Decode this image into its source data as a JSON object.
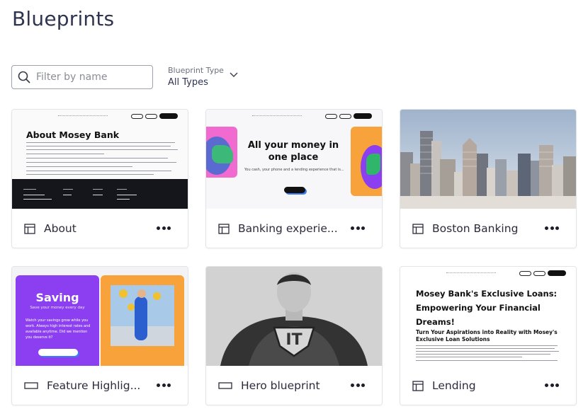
{
  "page": {
    "title": "Blueprints"
  },
  "filters": {
    "search_placeholder": "Filter by name",
    "type_label": "Blueprint Type",
    "type_value": "All Types"
  },
  "cards": [
    {
      "name": "About",
      "type_icon": "layout-template-icon",
      "thumb": {
        "heading": "About Mosey Bank"
      }
    },
    {
      "name": "Banking experie...",
      "type_icon": "layout-template-icon",
      "thumb": {
        "heading": "All your money in one place",
        "sub": "You cash, your phone and a lending experience that is..."
      }
    },
    {
      "name": "Boston Banking",
      "type_icon": "layout-template-icon",
      "thumb": {}
    },
    {
      "name": "Feature Highlig...",
      "type_icon": "section-icon",
      "thumb": {
        "heading": "Saving",
        "sub": "Save your money every day",
        "body": "Watch your savings grow while you work. Always high interest rates and available anytime. Did we mention you deserve it?"
      }
    },
    {
      "name": "Hero blueprint",
      "type_icon": "section-icon",
      "thumb": {
        "badge": "IT"
      }
    },
    {
      "name": "Lending",
      "type_icon": "layout-template-icon",
      "thumb": {
        "heading": "Mosey Bank's Exclusive Loans: Empowering Your Financial Dreams!",
        "sub": "Turn Your Aspirations into Reality with Mosey's Exclusive Loan Solutions"
      }
    }
  ],
  "colors": {
    "accent": "#2f3550",
    "purple": "#8b3ff0",
    "orange": "#f7a23b",
    "pink": "#f06ad0"
  }
}
